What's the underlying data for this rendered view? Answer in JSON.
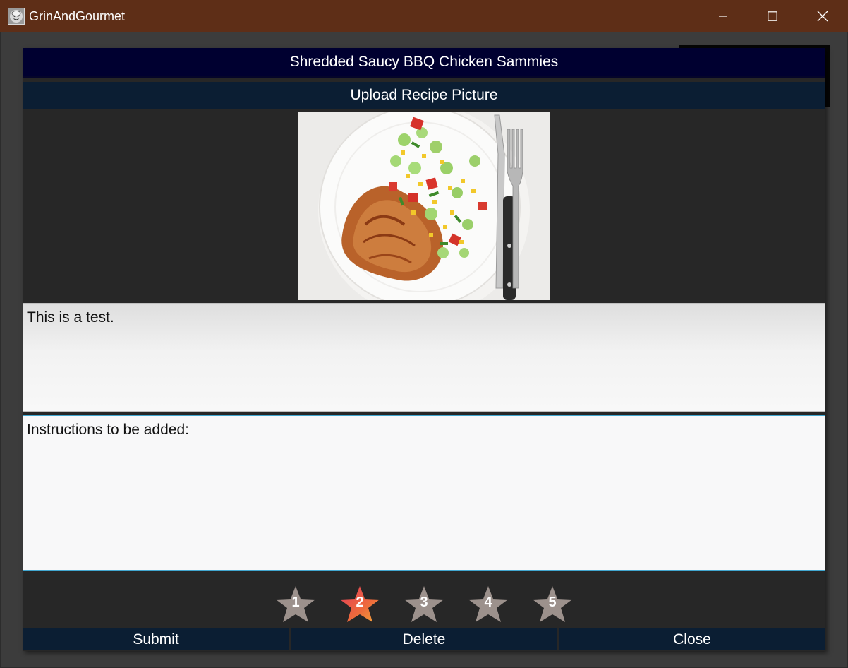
{
  "window": {
    "title": "GrinAndGourmet",
    "controls": {
      "minimize": "minimize-icon",
      "maximize": "maximize-icon",
      "close": "close-icon"
    }
  },
  "recipe": {
    "title": "Shredded Saucy BBQ Chicken Sammies",
    "upload_label": "Upload Recipe Picture",
    "description": "This is a test.",
    "instructions": "Instructions to be added:"
  },
  "rating": {
    "stars": [
      {
        "label": "1"
      },
      {
        "label": "2"
      },
      {
        "label": "3"
      },
      {
        "label": "4"
      },
      {
        "label": "5"
      }
    ],
    "selected": 2,
    "colors": {
      "selected": "#e8525a",
      "unselected": "#9c918c"
    }
  },
  "actions": {
    "submit": "Submit",
    "delete": "Delete",
    "close": "Close"
  },
  "colors": {
    "titlebar": "#5e2e17",
    "header_bg": "#000030",
    "button_bg": "#0b1e33",
    "panel_bg": "#272727",
    "focus_border": "#41a6cf"
  }
}
